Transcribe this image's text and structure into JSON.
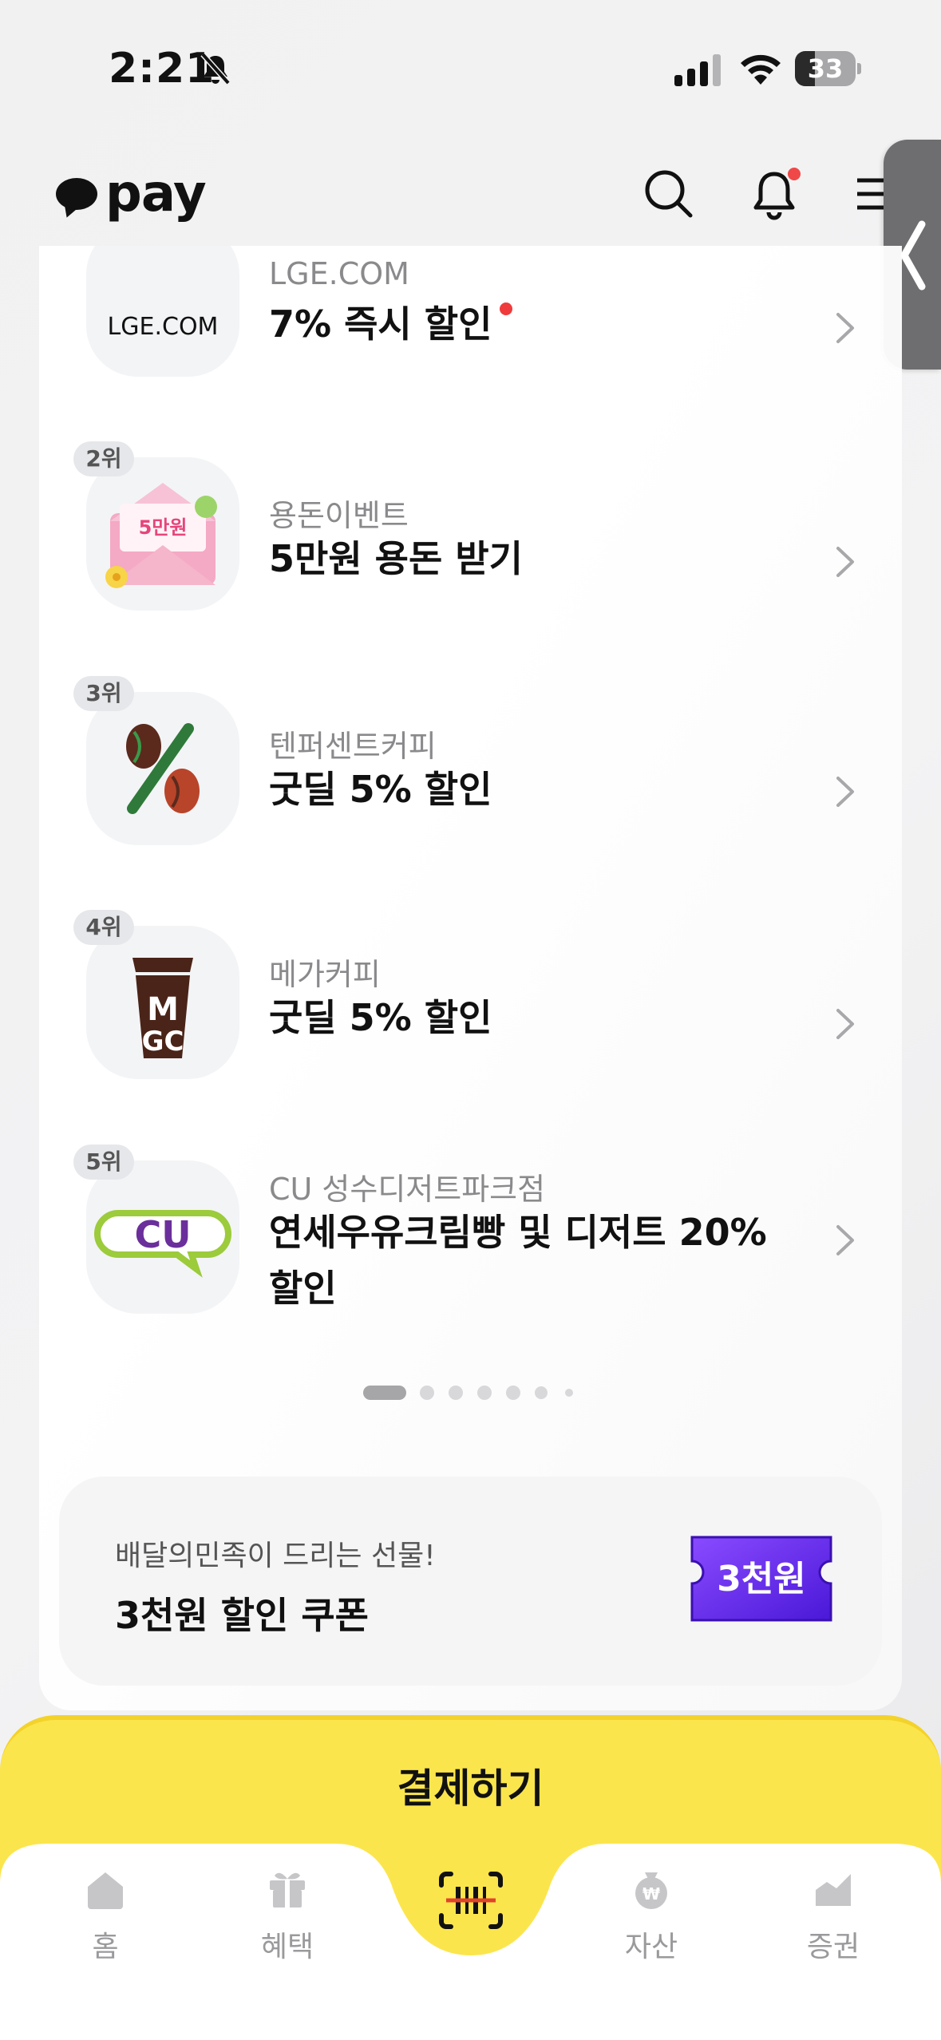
{
  "status_bar": {
    "time": "2:21",
    "battery_level": "33",
    "battery_fraction": 0.33
  },
  "header": {
    "logo_text": "pay",
    "icons": [
      "search-icon",
      "bell-icon",
      "menu-icon"
    ],
    "has_notification_dot": true
  },
  "ranking": [
    {
      "rank": "",
      "thumb": "LGE.COM",
      "merchant": "LGE.COM",
      "offer": "7% 즉시 할인",
      "new_dot": true
    },
    {
      "rank": "2위",
      "thumb_text": "5만원",
      "merchant": "용돈이벤트",
      "offer": "5만원 용돈 받기"
    },
    {
      "rank": "3위",
      "merchant": "텐퍼센트커피",
      "offer": "굿딜 5% 할인"
    },
    {
      "rank": "4위",
      "merchant": "메가커피",
      "offer": "굿딜 5% 할인"
    },
    {
      "rank": "5위",
      "thumb_text": "CU",
      "merchant": "CU 성수디저트파크점",
      "offer": "연세우유크림빵 및 디저트 20% 할인"
    }
  ],
  "pager": {
    "total": 7,
    "active": 1
  },
  "promo": {
    "subtitle": "배달의민족이 드리는 선물!",
    "title": "3천원 할인 쿠폰",
    "coupon_text": "3천원"
  },
  "pay_button": {
    "label": "결제하기"
  },
  "tabs": [
    {
      "label": "홈",
      "icon": "home-icon"
    },
    {
      "label": "혜택",
      "icon": "gift-icon"
    },
    {
      "label": "",
      "icon": "scan-icon"
    },
    {
      "label": "자산",
      "icon": "money-bag-icon"
    },
    {
      "label": "증권",
      "icon": "chart-icon"
    }
  ],
  "colors": {
    "accent_yellow": "#fbe54c",
    "notification_red": "#f04848",
    "coupon_purple": "#6a2ef0"
  }
}
